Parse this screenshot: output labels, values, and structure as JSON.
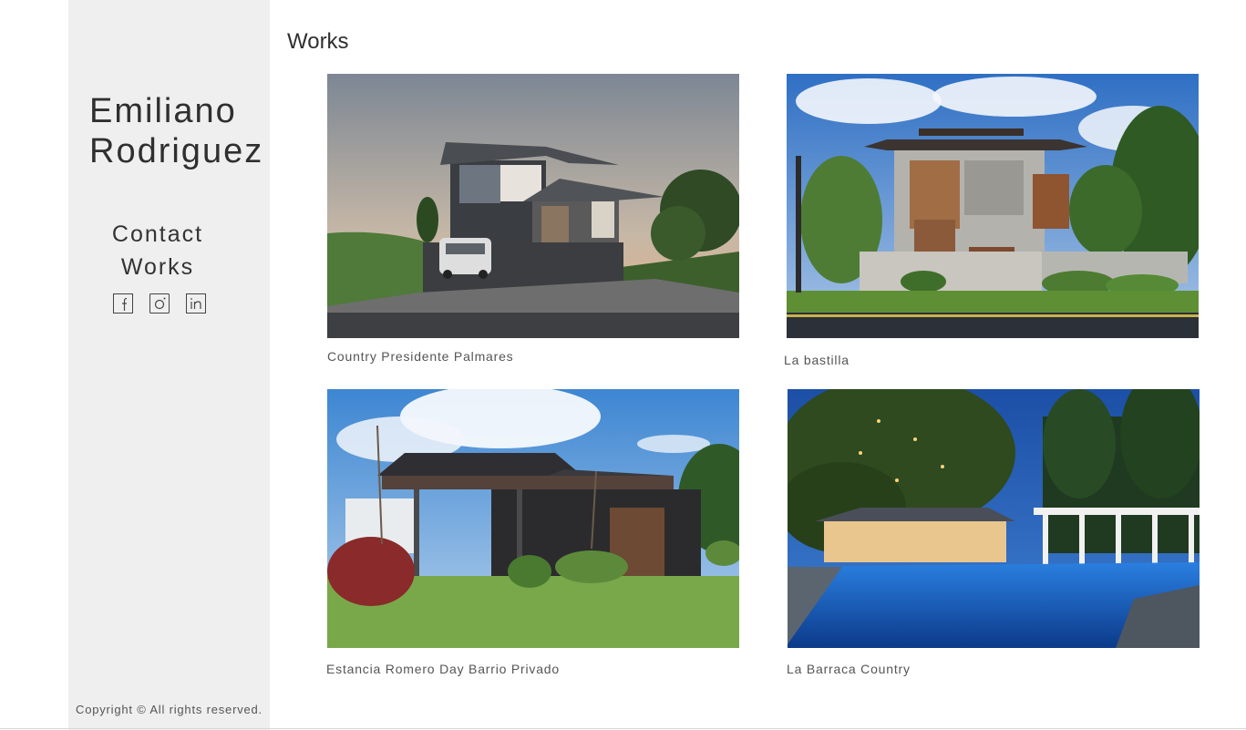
{
  "sidebar": {
    "name_line1": "Emiliano",
    "name_line2": "Rodriguez",
    "nav": {
      "contact": "Contact",
      "works": "Works"
    },
    "social_icons": [
      "facebook-icon",
      "instagram-icon",
      "linkedin-icon"
    ],
    "copyright": "Copyright © All rights reserved."
  },
  "main": {
    "title": "Works",
    "works": [
      {
        "caption": "Country Presidente Palmares"
      },
      {
        "caption": "La bastilla"
      },
      {
        "caption": "Estancia Romero Day Barrio Privado"
      },
      {
        "caption": "La Barraca Country"
      }
    ]
  },
  "colors": {
    "sidebar_bg": "#efefef",
    "text": "#333333",
    "caption": "#555555"
  }
}
